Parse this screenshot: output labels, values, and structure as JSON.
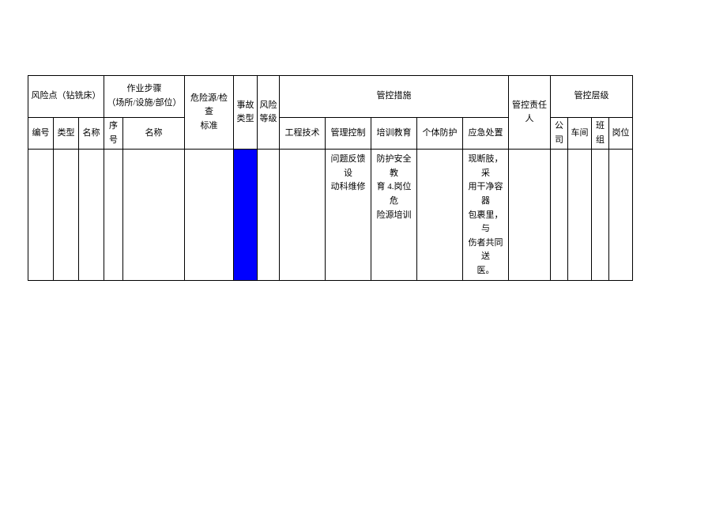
{
  "headers": {
    "riskPoint": "风险点（钻铣床）",
    "workSteps": "作业步骤\n（场所/设施/部位）",
    "hazardStd": "危险源/检查\n标准",
    "accidentType": "事故\n类型",
    "riskLevel": "风险\n等级",
    "controlMeasures": "管控措施",
    "respPerson": "管控责任人",
    "controlLevel": "管控层级",
    "sub": {
      "no": "编号",
      "type": "类型",
      "name": "名称",
      "seq": "序号",
      "stepName": "名称",
      "eng": "工程技术",
      "mgmt": "管理控制",
      "training": "培训教育",
      "ppe": "个体防护",
      "emergency": "应急处置",
      "company": "公\n司",
      "workshop": "车间",
      "team": "班\n组",
      "post": "岗位"
    }
  },
  "row": {
    "mgmt": "问题反馈设\n动科维修",
    "training": "防护安全教\n育 4.岗位危\n险源培训",
    "emergency": "现断肢，采\n用干净容器\n包裹里，与\n伤者共同送\n医。"
  }
}
